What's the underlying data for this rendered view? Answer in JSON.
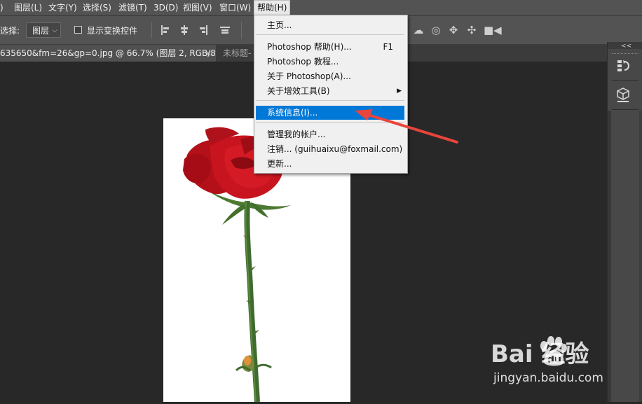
{
  "menubar": {
    "items": [
      {
        "label": ")"
      },
      {
        "label": "图层(L)"
      },
      {
        "label": "文字(Y)"
      },
      {
        "label": "选择(S)"
      },
      {
        "label": "滤镜(T)"
      },
      {
        "label": "3D(D)"
      },
      {
        "label": "视图(V)"
      },
      {
        "label": "窗口(W)"
      },
      {
        "label": "帮助(H)"
      }
    ]
  },
  "options": {
    "select_label": "选择:",
    "layer_select_value": "图层",
    "show_transform_label": "显示变换控件",
    "show_transform_checked": false
  },
  "tabs": [
    {
      "label": "635650&fm=26&gp=0.jpg @ 66.7% (图层 2, RGB/8) *",
      "close": "×"
    },
    {
      "label": "未标题-"
    }
  ],
  "help_menu": {
    "items": [
      {
        "label": "主页..."
      },
      {
        "label": "Photoshop 帮助(H)...",
        "shortcut": "F1"
      },
      {
        "label": "Photoshop 教程..."
      },
      {
        "label": "关于 Photoshop(A)..."
      },
      {
        "label": "关于增效工具(B)",
        "submenu_arrow": "▶"
      },
      {
        "label": "系统信息(I)...",
        "highlighted": true
      },
      {
        "label": "管理我的帐户..."
      },
      {
        "label": "注销... (guihuaixu@foxmail.com)"
      },
      {
        "label": "更新..."
      }
    ]
  },
  "right_panel": {
    "collapse_label": "<<"
  },
  "watermark": {
    "logo": "Bai  经验",
    "url": "jingyan.baidu.com"
  },
  "colors": {
    "menu_highlight": "#0078d7",
    "arrow": "#e8453c",
    "rose": "#c8141e",
    "stem": "#3f6b2e"
  }
}
